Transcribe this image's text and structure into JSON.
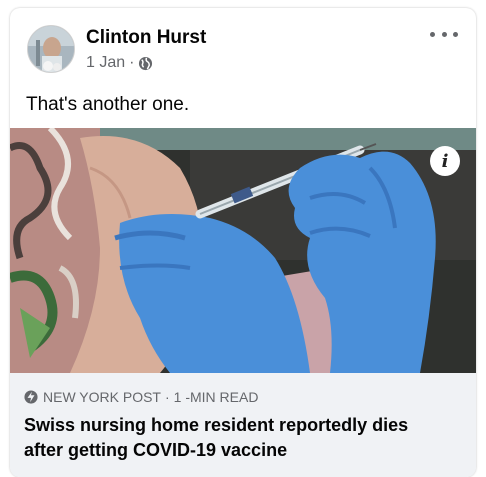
{
  "post": {
    "author": "Clinton Hurst",
    "date": "1 Jan",
    "separator": "·",
    "privacy_icon": "globe-icon",
    "more_icon": "more-options-icon",
    "text": "That's another one."
  },
  "link": {
    "image_description_icon": "info-icon",
    "info_glyph": "i",
    "source": "NEW YORK POST",
    "source_separator": "·",
    "read_time": "1 -MIN READ",
    "source_icon": "lightning-bolt-icon",
    "headline_line1": "Swiss nursing home resident reportedly dies",
    "headline_line2": "after getting COVID-19 vaccine"
  },
  "colors": {
    "text_primary": "#050505",
    "text_secondary": "#65676b",
    "footer_bg": "#f0f2f5",
    "glove_blue": "#4a8fd9"
  }
}
